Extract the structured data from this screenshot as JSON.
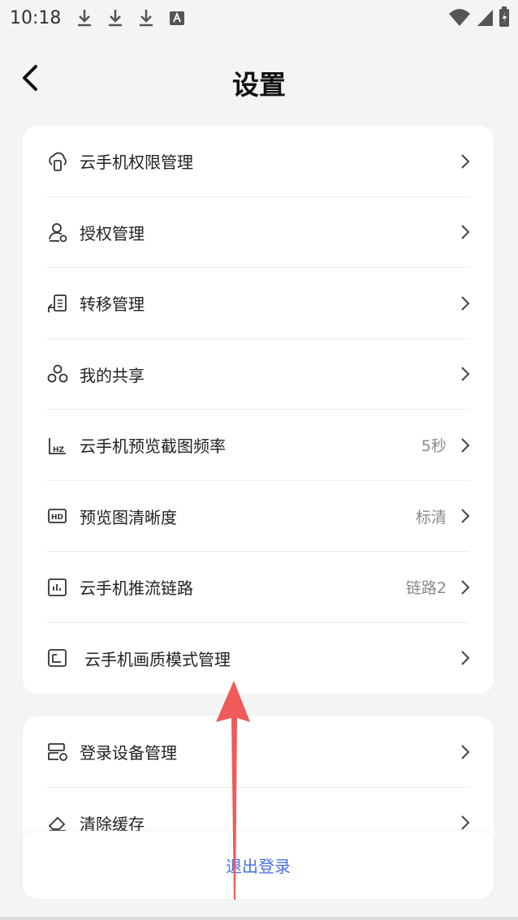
{
  "status_bar": {
    "time": "10:18",
    "icons": [
      "download-icon",
      "download-icon",
      "download-icon",
      "app-notification-icon",
      "wifi-icon",
      "signal-icon",
      "battery-icon"
    ]
  },
  "header": {
    "title": "设置",
    "back_icon": "back-arrow-icon"
  },
  "settings_group_1": [
    {
      "label": "云手机权限管理",
      "value": "",
      "icon": "cloud-phone-icon"
    },
    {
      "label": "授权管理",
      "value": "",
      "icon": "authorize-icon"
    },
    {
      "label": "转移管理",
      "value": "",
      "icon": "transfer-icon"
    },
    {
      "label": "我的共享",
      "value": "",
      "icon": "share-icon"
    },
    {
      "label": "云手机预览截图频率",
      "value": "5秒",
      "icon": "hz-frequency-icon"
    },
    {
      "label": "预览图清晰度",
      "value": "标清",
      "icon": "hd-icon"
    },
    {
      "label": "云手机推流链路",
      "value": "链路2",
      "icon": "stream-link-icon"
    },
    {
      "label": "云手机画质模式管理",
      "value": "",
      "icon": "quality-mode-icon"
    }
  ],
  "settings_group_2": [
    {
      "label": "登录设备管理",
      "icon": "login-device-icon"
    },
    {
      "label": "清除缓存",
      "icon": "eraser-icon"
    }
  ],
  "logout": {
    "label": "退出登录"
  },
  "colors": {
    "background": "#f4f4f4",
    "card": "#ffffff",
    "accent_link": "#4a6fe8",
    "annotation_arrow": "#f05a5a"
  }
}
